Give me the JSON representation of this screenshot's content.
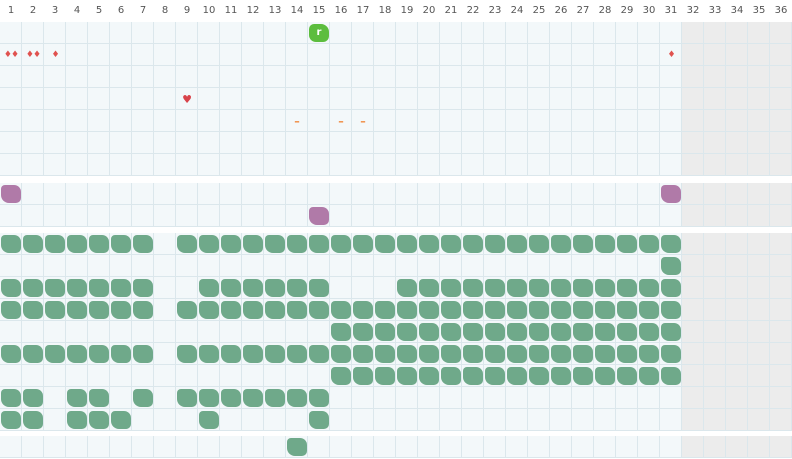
{
  "calendar": {
    "days": [
      "1",
      "2",
      "3",
      "4",
      "5",
      "6",
      "7",
      "8",
      "9",
      "10",
      "11",
      "12",
      "13",
      "14",
      "15",
      "16",
      "17",
      "18",
      "19",
      "20",
      "21",
      "22",
      "23",
      "24",
      "25",
      "26",
      "27",
      "28",
      "29",
      "30",
      "31",
      "32",
      "33",
      "34",
      "35",
      "36"
    ],
    "valid_days": 31
  },
  "colors": {
    "cell_bg": "#f3f8fa",
    "cell_disabled_bg": "#ececec",
    "grid_line": "#dbe7ec",
    "green_mark": "#6fa98a",
    "purple_mark": "#b07aa8",
    "bright_green_badge": "#5cbd3e",
    "red_drop": "#e0524f",
    "orange_dash": "#f0873a"
  },
  "section_top": {
    "rows": [
      {
        "marks": [
          {
            "day": 15,
            "kind": "badge",
            "label": "r"
          }
        ]
      },
      {
        "marks": [
          {
            "day": 1,
            "kind": "drops",
            "label": "♦♦"
          },
          {
            "day": 2,
            "kind": "drops",
            "label": "♦♦"
          },
          {
            "day": 3,
            "kind": "drops",
            "label": "♦"
          },
          {
            "day": 31,
            "kind": "drops",
            "label": "♦"
          }
        ]
      },
      {
        "marks": []
      },
      {
        "marks": [
          {
            "day": 9,
            "kind": "heart",
            "label": "♥"
          }
        ]
      },
      {
        "marks": [
          {
            "day": 14,
            "kind": "dash",
            "label": "–"
          },
          {
            "day": 16,
            "kind": "dash",
            "label": "–"
          },
          {
            "day": 17,
            "kind": "dash",
            "label": "–"
          }
        ]
      },
      {
        "marks": []
      },
      {
        "marks": []
      }
    ]
  },
  "section_purple": {
    "rows": [
      {
        "days": [
          1,
          31
        ]
      },
      {
        "days": [
          15
        ]
      }
    ]
  },
  "section_habits": {
    "rows": [
      {
        "days": [
          1,
          2,
          3,
          4,
          5,
          6,
          7,
          9,
          10,
          11,
          12,
          13,
          14,
          15,
          16,
          17,
          18,
          19,
          20,
          21,
          22,
          23,
          24,
          25,
          26,
          27,
          28,
          29,
          30,
          31
        ]
      },
      {
        "days": [
          31
        ]
      },
      {
        "days": [
          1,
          2,
          3,
          4,
          5,
          6,
          7,
          10,
          11,
          12,
          13,
          14,
          15,
          19,
          20,
          21,
          22,
          23,
          24,
          25,
          26,
          27,
          28,
          29,
          30,
          31
        ]
      },
      {
        "days": [
          1,
          2,
          3,
          4,
          5,
          6,
          7,
          9,
          10,
          11,
          12,
          13,
          14,
          15,
          16,
          17,
          18,
          19,
          20,
          21,
          22,
          23,
          24,
          25,
          26,
          27,
          28,
          29,
          30,
          31
        ]
      },
      {
        "days": [
          16,
          17,
          18,
          19,
          20,
          21,
          22,
          23,
          24,
          25,
          26,
          27,
          28,
          29,
          30,
          31
        ]
      },
      {
        "days": [
          1,
          2,
          3,
          4,
          5,
          6,
          7,
          9,
          10,
          11,
          12,
          13,
          14,
          15,
          16,
          17,
          18,
          19,
          20,
          21,
          22,
          23,
          24,
          25,
          26,
          27,
          28,
          29,
          30,
          31
        ]
      },
      {
        "days": [
          16,
          17,
          18,
          19,
          20,
          21,
          22,
          23,
          24,
          25,
          26,
          27,
          28,
          29,
          30,
          31
        ]
      },
      {
        "days": [
          1,
          2,
          4,
          5,
          7,
          9,
          10,
          11,
          12,
          13,
          14,
          15
        ]
      },
      {
        "days": [
          1,
          2,
          4,
          5,
          6,
          10,
          15
        ]
      }
    ]
  },
  "section_bottom": {
    "rows": [
      {
        "days": [
          14
        ]
      }
    ]
  }
}
